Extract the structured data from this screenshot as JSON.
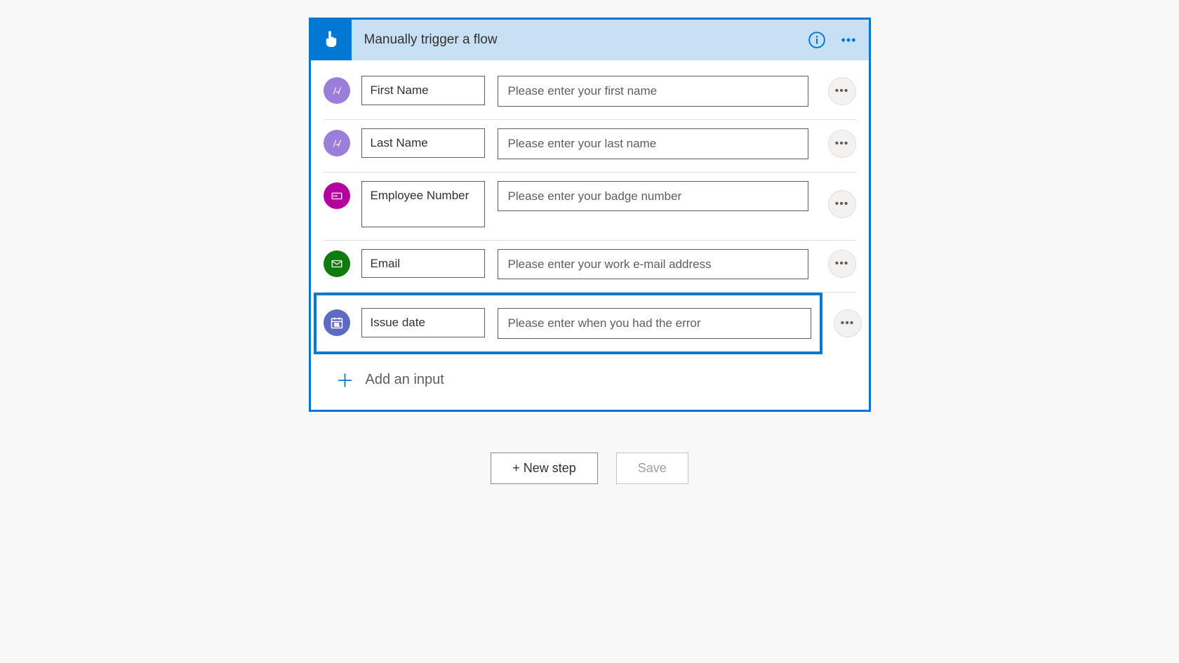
{
  "header": {
    "title": "Manually trigger a flow"
  },
  "inputs": [
    {
      "label": "First Name",
      "placeholder": "Please enter your first name"
    },
    {
      "label": "Last Name",
      "placeholder": "Please enter your last name"
    },
    {
      "label": "Employee Number",
      "placeholder": "Please enter your badge number"
    },
    {
      "label": "Email",
      "placeholder": "Please enter your work e-mail address"
    },
    {
      "label": "Issue date",
      "placeholder": "Please enter when you had the error"
    }
  ],
  "addInput": "Add an input",
  "footer": {
    "newStep": "+ New step",
    "save": "Save"
  }
}
